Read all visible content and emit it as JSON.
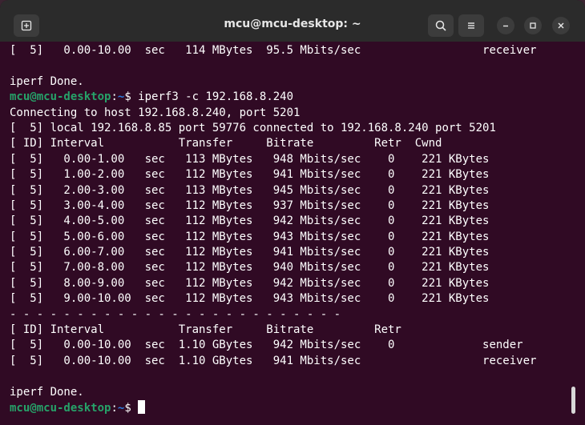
{
  "window": {
    "title": "mcu@mcu-desktop: ~"
  },
  "terminal": {
    "prompt": {
      "user": "mcu@mcu-desktop",
      "sep": ":",
      "path": "~",
      "suffix": "$ "
    },
    "lines": [
      "[  5]   0.00-10.00  sec   114 MBytes  95.5 Mbits/sec                  receiver",
      "",
      "iperf Done.",
      "PROMPT iperf3 -c 192.168.8.240",
      "Connecting to host 192.168.8.240, port 5201",
      "[  5] local 192.168.8.85 port 59776 connected to 192.168.8.240 port 5201",
      "[ ID] Interval           Transfer     Bitrate         Retr  Cwnd",
      "[  5]   0.00-1.00   sec   113 MBytes   948 Mbits/sec    0    221 KBytes",
      "[  5]   1.00-2.00   sec   112 MBytes   941 Mbits/sec    0    221 KBytes",
      "[  5]   2.00-3.00   sec   113 MBytes   945 Mbits/sec    0    221 KBytes",
      "[  5]   3.00-4.00   sec   112 MBytes   937 Mbits/sec    0    221 KBytes",
      "[  5]   4.00-5.00   sec   112 MBytes   942 Mbits/sec    0    221 KBytes",
      "[  5]   5.00-6.00   sec   112 MBytes   943 Mbits/sec    0    221 KBytes",
      "[  5]   6.00-7.00   sec   112 MBytes   941 Mbits/sec    0    221 KBytes",
      "[  5]   7.00-8.00   sec   112 MBytes   940 Mbits/sec    0    221 KBytes",
      "[  5]   8.00-9.00   sec   112 MBytes   942 Mbits/sec    0    221 KBytes",
      "[  5]   9.00-10.00  sec   112 MBytes   943 Mbits/sec    0    221 KBytes",
      "- - - - - - - - - - - - - - - - - - - - - - - - -",
      "[ ID] Interval           Transfer     Bitrate         Retr",
      "[  5]   0.00-10.00  sec  1.10 GBytes   942 Mbits/sec    0             sender",
      "[  5]   0.00-10.00  sec  1.10 GBytes   941 Mbits/sec                  receiver",
      "",
      "iperf Done.",
      "PROMPT_CURSOR"
    ]
  },
  "icons": {
    "new_tab": "new-tab-icon",
    "search": "search-icon",
    "menu": "hamburger-menu-icon",
    "minimize": "minimize-icon",
    "maximize": "maximize-icon",
    "close": "close-icon"
  }
}
